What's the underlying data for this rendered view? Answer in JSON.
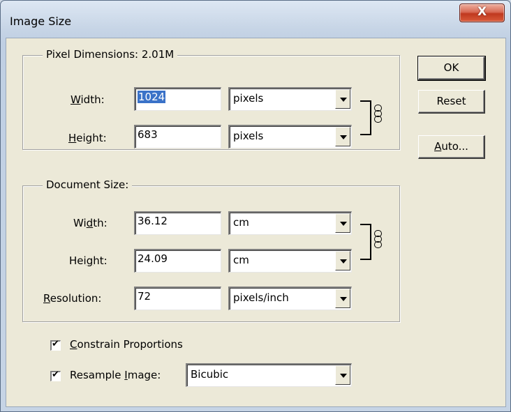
{
  "window": {
    "title": "Image Size",
    "close_glyph": "X"
  },
  "pixel_dimensions": {
    "label": "Pixel Dimensions:",
    "size": "2.01M",
    "width": {
      "label_pre": "",
      "label_key": "W",
      "label_post": "idth:",
      "value": "1024",
      "unit": "pixels"
    },
    "height": {
      "label_pre": "",
      "label_key": "H",
      "label_post": "eight:",
      "value": "683",
      "unit": "pixels"
    }
  },
  "document_size": {
    "label": "Document Size:",
    "width": {
      "label_pre": "Wi",
      "label_key": "d",
      "label_post": "th:",
      "value": "36.12",
      "unit": "cm"
    },
    "height": {
      "label_pre": "Hei",
      "label_key": "g",
      "label_post": "ht:",
      "value": "24.09",
      "unit": "cm"
    },
    "resolution": {
      "label_pre": "",
      "label_key": "R",
      "label_post": "esolution:",
      "value": "72",
      "unit": "pixels/inch"
    }
  },
  "options": {
    "constrain": {
      "label_key": "C",
      "label_post": "onstrain Proportions",
      "checked": true
    },
    "resample": {
      "label_pre": "Resample ",
      "label_key": "I",
      "label_post": "mage:",
      "checked": true,
      "method": "Bicubic"
    }
  },
  "buttons": {
    "ok": "OK",
    "reset": "Reset",
    "auto_key": "A",
    "auto_post": "uto..."
  },
  "icons": {
    "close": "close-icon",
    "chain": "chain-link-icon",
    "dropdown": "chevron-down-icon",
    "checkmark": "checkmark-icon"
  },
  "colors": {
    "dialog_face": "#ece9d8",
    "selection": "#3a72c8",
    "close_button": "#c0391f",
    "window_frame": "#c7d5e6"
  }
}
